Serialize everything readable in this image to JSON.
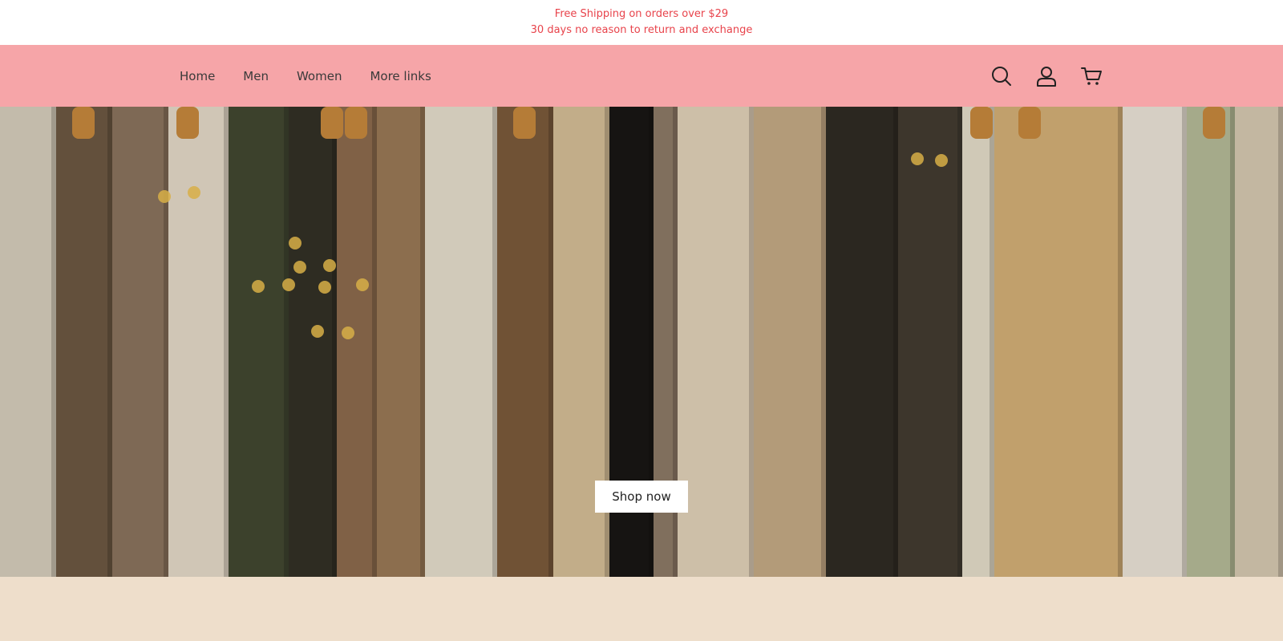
{
  "announcement": {
    "line1": "Free Shipping on orders over $29",
    "line2": "30 days no reason to return and exchange",
    "color": "#e8434b"
  },
  "nav": {
    "background": "#f6a5a8",
    "links": [
      "Home",
      "Men",
      "Women",
      "More links"
    ],
    "icons": [
      "search-icon",
      "account-icon",
      "cart-icon"
    ]
  },
  "hero": {
    "image": "clothing-rack-photo",
    "cta_label": "Shop now"
  },
  "footer_band": {
    "background": "#eedecb"
  }
}
